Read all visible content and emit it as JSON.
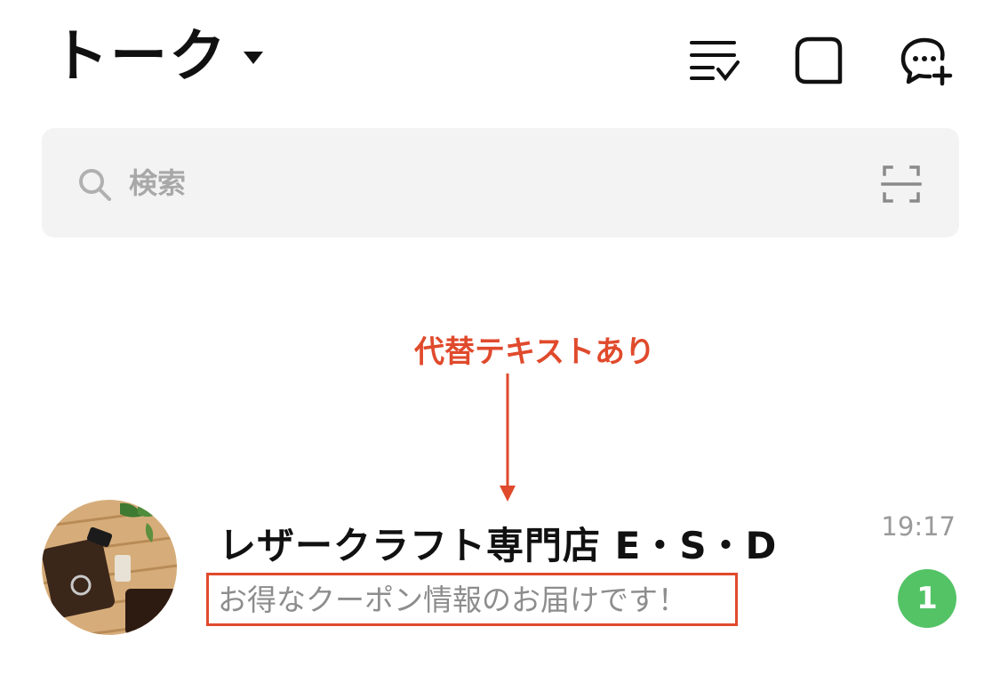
{
  "header": {
    "title": "トーク",
    "icons": [
      "sort-check-icon",
      "square-icon",
      "new-chat-icon"
    ]
  },
  "search": {
    "placeholder": "検索",
    "icon": "search-icon",
    "scan_icon": "qr-scan-icon"
  },
  "annotation": {
    "label": "代替テキストあり",
    "color": "#e04a2c"
  },
  "chat": {
    "name": "レザークラフト専門店 E・S・D",
    "preview": "お得なクーポン情報のお届けです！",
    "time": "19:17",
    "unread": "1",
    "badge_color": "#54c366"
  }
}
